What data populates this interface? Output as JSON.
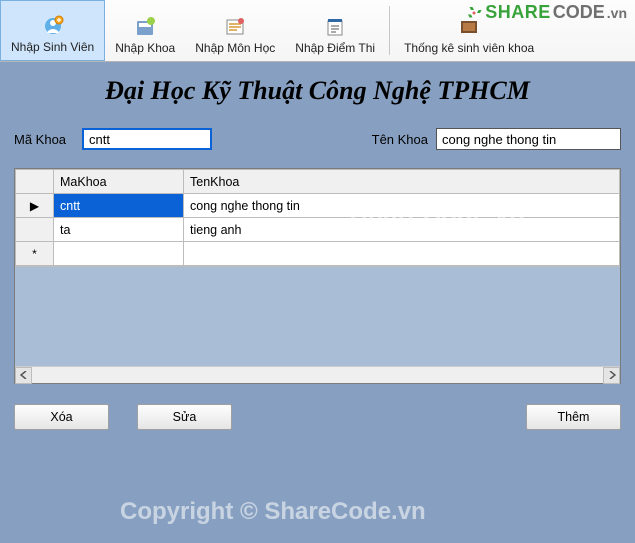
{
  "toolbar": {
    "items": [
      {
        "label": "Nhập Sinh Viên",
        "icon": "person-plus-icon",
        "active": true
      },
      {
        "label": "Nhập Khoa",
        "icon": "dept-icon",
        "active": false
      },
      {
        "label": "Nhập Môn Học",
        "icon": "subject-icon",
        "active": false
      },
      {
        "label": "Nhập Điểm Thi",
        "icon": "score-icon",
        "active": false
      },
      {
        "label": "Thống kê sinh viên khoa",
        "icon": "report-icon",
        "active": false
      }
    ]
  },
  "brand": {
    "text_green": "SHARE",
    "text_gray": "CODE",
    "suffix": ".vn"
  },
  "header": {
    "title": "Đại Học Kỹ Thuật Công Nghệ TPHCM"
  },
  "form": {
    "maKhoa": {
      "label": "Mã Khoa",
      "value": "cntt"
    },
    "tenKhoa": {
      "label": "Tên Khoa",
      "value": "cong nghe thong tin"
    }
  },
  "grid": {
    "columns": [
      {
        "key": "MaKhoa",
        "header": "MaKhoa"
      },
      {
        "key": "TenKhoa",
        "header": "TenKhoa"
      }
    ],
    "rows": [
      {
        "MaKhoa": "cntt",
        "TenKhoa": "cong nghe thong tin",
        "current": true
      },
      {
        "MaKhoa": "ta",
        "TenKhoa": "tieng anh",
        "current": false
      }
    ],
    "row_indicator": "▶",
    "new_row_indicator": "*"
  },
  "buttons": {
    "delete": "Xóa",
    "edit": "Sửa",
    "add": "Thêm"
  },
  "watermarks": {
    "wm1": "ShareCode.vn",
    "wm2": "Copyright © ShareCode.vn"
  }
}
